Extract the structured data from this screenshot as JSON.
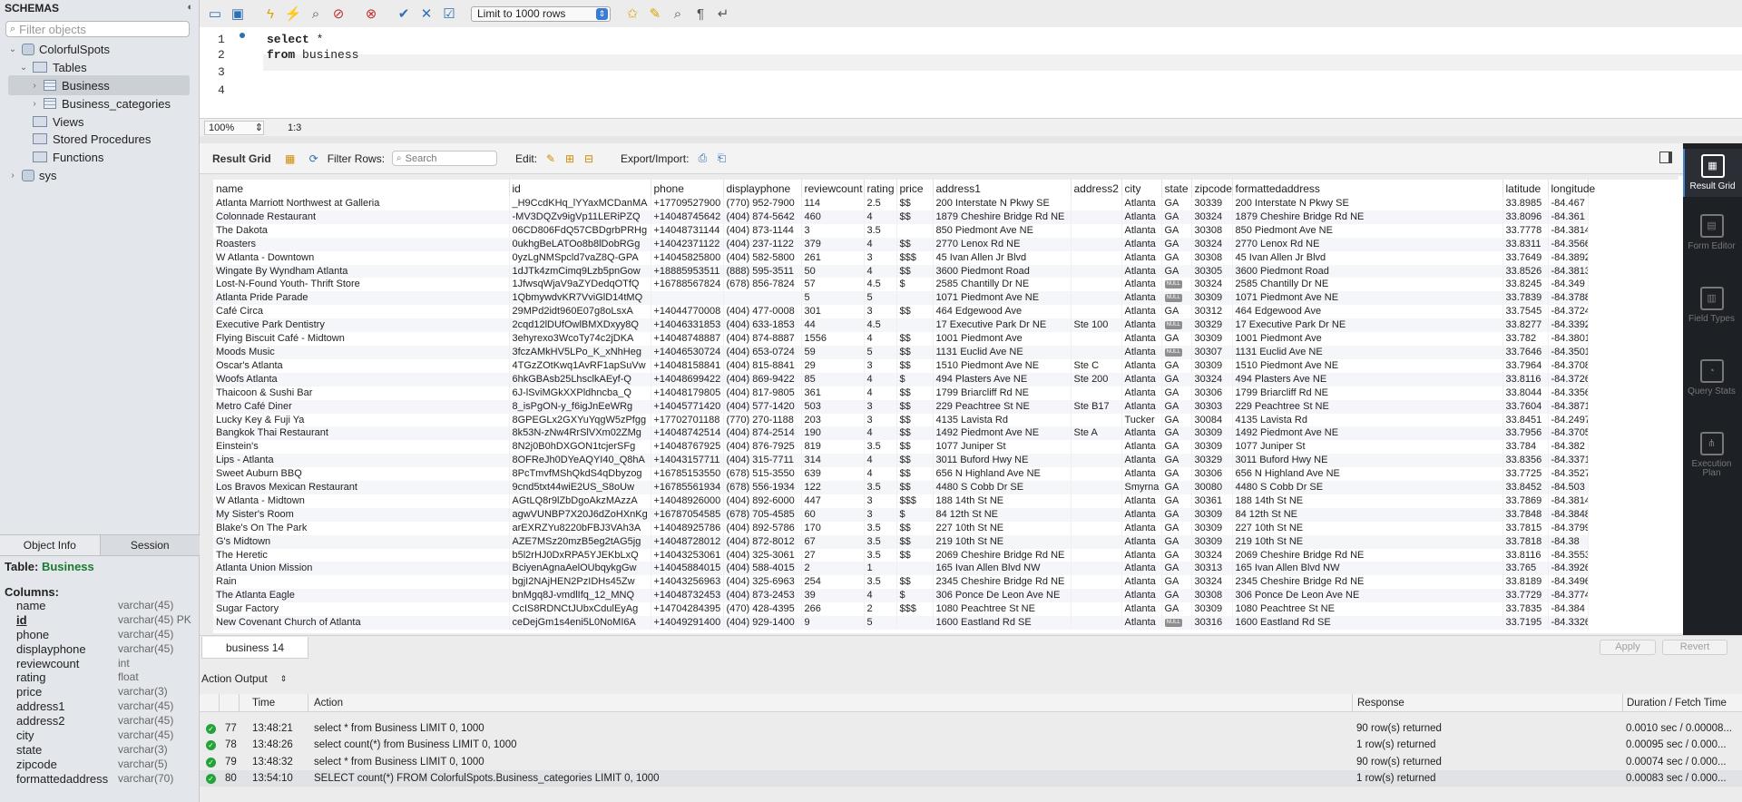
{
  "sidebar": {
    "title": "SCHEMAS",
    "filter_placeholder": "Filter objects",
    "tree": [
      {
        "label": "ColorfulSpots",
        "type": "db",
        "arrow": "⌄"
      },
      {
        "label": "Tables",
        "type": "folder",
        "arrow": "⌄"
      },
      {
        "label": "Business",
        "type": "table",
        "arrow": "›",
        "selected": true
      },
      {
        "label": "Business_categories",
        "type": "table",
        "arrow": "›"
      },
      {
        "label": "Views",
        "type": "folder",
        "arrow": ""
      },
      {
        "label": "Stored Procedures",
        "type": "folder",
        "arrow": ""
      },
      {
        "label": "Functions",
        "type": "folder",
        "arrow": ""
      },
      {
        "label": "sys",
        "type": "db",
        "arrow": "›"
      }
    ]
  },
  "object_info": {
    "tabs": [
      "Object Info",
      "Session"
    ],
    "table_prefix": "Table:",
    "table_name": "Business",
    "columns_label": "Columns:",
    "columns": [
      {
        "name": "name",
        "type": "varchar(45)"
      },
      {
        "name": "id",
        "type": "varchar(45) PK",
        "pk": true
      },
      {
        "name": "phone",
        "type": "varchar(45)"
      },
      {
        "name": "displayphone",
        "type": "varchar(45)"
      },
      {
        "name": "reviewcount",
        "type": "int"
      },
      {
        "name": "rating",
        "type": "float"
      },
      {
        "name": "price",
        "type": "varchar(3)"
      },
      {
        "name": "address1",
        "type": "varchar(45)"
      },
      {
        "name": "address2",
        "type": "varchar(45)"
      },
      {
        "name": "city",
        "type": "varchar(45)"
      },
      {
        "name": "state",
        "type": "varchar(3)"
      },
      {
        "name": "zipcode",
        "type": "varchar(5)"
      },
      {
        "name": "formattedaddress",
        "type": "varchar(70)"
      }
    ]
  },
  "toolbar": {
    "limit_label": "Limit to 1000 rows"
  },
  "editor": {
    "lines": [
      "1",
      "2",
      "3",
      "4"
    ],
    "code_line1_kw": "select",
    "code_line1_rest": " *",
    "code_line2_kw": "from",
    "code_line2_rest": " business",
    "zoom": "100%",
    "position": "1:3"
  },
  "result_toolbar": {
    "result_grid": "Result Grid",
    "filter_rows": "Filter Rows:",
    "search_placeholder": "Search",
    "edit": "Edit:",
    "export_import": "Export/Import:"
  },
  "grid": {
    "columns": [
      "name",
      "id",
      "phone",
      "displayphone",
      "reviewcount",
      "rating",
      "price",
      "address1",
      "address2",
      "city",
      "state",
      "zipcode",
      "formattedaddress",
      "latitude",
      "longitude"
    ],
    "rows": [
      [
        "Atlanta Marriott Northwest at Galleria",
        "_H9CcdKHq_lYYaxMCDanMA",
        "+17709527900",
        "(770) 952-7900",
        "114",
        "2.5",
        "$$",
        "200 Interstate N Pkwy SE",
        "",
        "Atlanta",
        "GA",
        "30339",
        "200 Interstate N Pkwy SE",
        "33.8985",
        "-84.467"
      ],
      [
        "Colonnade Restaurant",
        "-MV3DQZv9igVp11LERiPZQ",
        "+14048745642",
        "(404) 874-5642",
        "460",
        "4",
        "$$",
        "1879 Cheshire Bridge Rd NE",
        "",
        "Atlanta",
        "GA",
        "30324",
        "1879 Cheshire Bridge Rd NE",
        "33.8096",
        "-84.361"
      ],
      [
        "The Dakota",
        "06CD806FdQ57CBDgrbPRHg",
        "+14048731144",
        "(404) 873-1144",
        "3",
        "3.5",
        "",
        "850 Piedmont Ave NE",
        "",
        "Atlanta",
        "GA",
        "30308",
        "850 Piedmont Ave NE",
        "33.7778",
        "-84.3814"
      ],
      [
        "Roasters",
        "0ukhgBeLATOo8b8lDobRGg",
        "+14042371122",
        "(404) 237-1122",
        "379",
        "4",
        "$$",
        "2770 Lenox Rd NE",
        "",
        "Atlanta",
        "GA",
        "30324",
        "2770 Lenox Rd NE",
        "33.8311",
        "-84.3566"
      ],
      [
        "W Atlanta - Downtown",
        "0yzLgNMSpcld7vaZ8Q-GPA",
        "+14045825800",
        "(404) 582-5800",
        "261",
        "3",
        "$$$",
        "45 Ivan Allen Jr Blvd",
        "",
        "Atlanta",
        "GA",
        "30308",
        "45 Ivan Allen Jr Blvd",
        "33.7649",
        "-84.3892"
      ],
      [
        "Wingate By Wyndham Atlanta",
        "1dJTk4zmCimq9Lzb5pnGow",
        "+18885953511",
        "(888) 595-3511",
        "50",
        "4",
        "$$",
        "3600 Piedmont Road",
        "",
        "Atlanta",
        "GA",
        "30305",
        "3600 Piedmont Road",
        "33.8526",
        "-84.3813"
      ],
      [
        "Lost-N-Found Youth- Thrift Store",
        "1JfwsqWjaV9aZYDedqOTfQ",
        "+16788567824",
        "(678) 856-7824",
        "57",
        "4.5",
        "$",
        "2585 Chantilly Dr NE",
        "",
        "Atlanta",
        "NULL",
        "30324",
        "2585 Chantilly Dr NE",
        "33.8245",
        "-84.349"
      ],
      [
        "Atlanta Pride Parade",
        "1QbmywdvKR7VviGlD14tMQ",
        "",
        "",
        "5",
        "5",
        "",
        "1071 Piedmont Ave NE",
        "",
        "Atlanta",
        "NULL",
        "30309",
        "1071 Piedmont Ave NE",
        "33.7839",
        "-84.3788"
      ],
      [
        "Café Circa",
        "29MPd2idt960E07g8oLsxA",
        "+14044770008",
        "(404) 477-0008",
        "301",
        "3",
        "$$",
        "464 Edgewood Ave",
        "",
        "Atlanta",
        "GA",
        "30312",
        "464 Edgewood Ave",
        "33.7545",
        "-84.3724"
      ],
      [
        "Executive Park Dentistry",
        "2cqd12lDUfOwlBMXDxyy8Q",
        "+14046331853",
        "(404) 633-1853",
        "44",
        "4.5",
        "",
        "17 Executive Park Dr NE",
        "Ste 100",
        "Atlanta",
        "NULL",
        "30329",
        "17 Executive Park Dr NE",
        "33.8277",
        "-84.3392"
      ],
      [
        "Flying Biscuit Café - Midtown",
        "3ehyrexo3WcoTy74c2jDKA",
        "+14048748887",
        "(404) 874-8887",
        "1556",
        "4",
        "$$",
        "1001 Piedmont Ave",
        "",
        "Atlanta",
        "GA",
        "30309",
        "1001 Piedmont Ave",
        "33.782",
        "-84.3801"
      ],
      [
        "Moods Music",
        "3fczAMkHV5LPo_K_xNhHeg",
        "+14046530724",
        "(404) 653-0724",
        "59",
        "5",
        "$$",
        "1131 Euclid Ave NE",
        "",
        "Atlanta",
        "NULL",
        "30307",
        "1131 Euclid Ave NE",
        "33.7646",
        "-84.3501"
      ],
      [
        "Oscar's Atlanta",
        "4TGzZOtKwq1AvRF1apSuVw",
        "+14048158841",
        "(404) 815-8841",
        "29",
        "3",
        "$$",
        "1510 Piedmont Ave NE",
        "Ste C",
        "Atlanta",
        "GA",
        "30309",
        "1510 Piedmont Ave NE",
        "33.7964",
        "-84.3708"
      ],
      [
        "Woofs Atlanta",
        "6hkGBAsb25LhsclkAEyf-Q",
        "+14048699422",
        "(404) 869-9422",
        "85",
        "4",
        "$",
        "494 Plasters Ave NE",
        "Ste 200",
        "Atlanta",
        "GA",
        "30324",
        "494 Plasters Ave NE",
        "33.8116",
        "-84.3726"
      ],
      [
        "Thaicoon & Sushi Bar",
        "6J-lSviMGkXXPldhncba_Q",
        "+14048179805",
        "(404) 817-9805",
        "361",
        "4",
        "$$",
        "1799 Briarcliff Rd NE",
        "",
        "Atlanta",
        "GA",
        "30306",
        "1799 Briarcliff Rd NE",
        "33.8044",
        "-84.3356"
      ],
      [
        "Metro Café Diner",
        "8_isPgON-y_f6igJnEeWRg",
        "+14045771420",
        "(404) 577-1420",
        "503",
        "3",
        "$$",
        "229 Peachtree St NE",
        "Ste B17",
        "Atlanta",
        "GA",
        "30303",
        "229 Peachtree St NE",
        "33.7604",
        "-84.3871"
      ],
      [
        "Lucky Key & Fuji Ya",
        "8GPEGLx2GXYuYqgW5zPfgg",
        "+17702701188",
        "(770) 270-1188",
        "203",
        "3",
        "$$",
        "4135 Lavista Rd",
        "",
        "Tucker",
        "GA",
        "30084",
        "4135 Lavista Rd",
        "33.8451",
        "-84.2497"
      ],
      [
        "Bangkok Thai Restaurant",
        "8k53N-zNw4RrSlVXm02ZMg",
        "+14048742514",
        "(404) 874-2514",
        "190",
        "4",
        "$$",
        "1492 Piedmont Ave NE",
        "Ste A",
        "Atlanta",
        "GA",
        "30309",
        "1492 Piedmont Ave NE",
        "33.7956",
        "-84.3705"
      ],
      [
        "Einstein's",
        "8N2j0B0hDXGON1tcjerSFg",
        "+14048767925",
        "(404) 876-7925",
        "819",
        "3.5",
        "$$",
        "1077 Juniper St",
        "",
        "Atlanta",
        "GA",
        "30309",
        "1077 Juniper St",
        "33.784",
        "-84.382"
      ],
      [
        "Lips - Atlanta",
        "8OFReJh0DYeAQYI40_Q8hA",
        "+14043157711",
        "(404) 315-7711",
        "314",
        "4",
        "$$",
        "3011 Buford Hwy NE",
        "",
        "Atlanta",
        "GA",
        "30329",
        "3011 Buford Hwy NE",
        "33.8356",
        "-84.3371"
      ],
      [
        "Sweet Auburn BBQ",
        "8PcTmvfMShQkdS4qDbyzog",
        "+16785153550",
        "(678) 515-3550",
        "639",
        "4",
        "$$",
        "656 N Highland Ave NE",
        "",
        "Atlanta",
        "GA",
        "30306",
        "656 N Highland Ave NE",
        "33.7725",
        "-84.3527"
      ],
      [
        "Los Bravos Mexican Restaurant",
        "9cnd5txt44wiE2US_S8oUw",
        "+16785561934",
        "(678) 556-1934",
        "122",
        "3.5",
        "$$",
        "4480 S Cobb Dr SE",
        "",
        "Smyrna",
        "GA",
        "30080",
        "4480 S Cobb Dr SE",
        "33.8452",
        "-84.503"
      ],
      [
        "W Atlanta - Midtown",
        "AGtLQ8r9lZbDgoAkzMAzzA",
        "+14048926000",
        "(404) 892-6000",
        "447",
        "3",
        "$$$",
        "188 14th St NE",
        "",
        "Atlanta",
        "GA",
        "30361",
        "188 14th St NE",
        "33.7869",
        "-84.3814"
      ],
      [
        "My Sister's Room",
        "agwVUNBP7X20J6dZoHXnKg",
        "+16787054585",
        "(678) 705-4585",
        "60",
        "3",
        "$",
        "84 12th St NE",
        "",
        "Atlanta",
        "GA",
        "30309",
        "84 12th St NE",
        "33.7848",
        "-84.3848"
      ],
      [
        "Blake's On The Park",
        "arEXRZYu8220bFBJ3VAh3A",
        "+14048925786",
        "(404) 892-5786",
        "170",
        "3.5",
        "$$",
        "227 10th St NE",
        "",
        "Atlanta",
        "GA",
        "30309",
        "227 10th St NE",
        "33.7815",
        "-84.3799"
      ],
      [
        "G's Midtown",
        "AZE7MSz20mzB5eg2tAG5jg",
        "+14048728012",
        "(404) 872-8012",
        "67",
        "3.5",
        "$$",
        "219 10th St NE",
        "",
        "Atlanta",
        "GA",
        "30309",
        "219 10th St NE",
        "33.7818",
        "-84.38"
      ],
      [
        "The Heretic",
        "b5l2rHJ0DxRPA5YJEKbLxQ",
        "+14043253061",
        "(404) 325-3061",
        "27",
        "3.5",
        "$$",
        "2069 Cheshire Bridge Rd NE",
        "",
        "Atlanta",
        "GA",
        "30324",
        "2069 Cheshire Bridge Rd NE",
        "33.8116",
        "-84.3553"
      ],
      [
        "Atlanta Union Mission",
        "BciyenAgnaAelOUbqykgGw",
        "+14045884015",
        "(404) 588-4015",
        "2",
        "1",
        "",
        "165 Ivan Allen Blvd NW",
        "",
        "Atlanta",
        "GA",
        "30313",
        "165 Ivan Allen Blvd NW",
        "33.765",
        "-84.3926"
      ],
      [
        "Rain",
        "bgjI2NAjHEN2PzIDHs45Zw",
        "+14043256963",
        "(404) 325-6963",
        "254",
        "3.5",
        "$$",
        "2345 Cheshire Bridge Rd NE",
        "",
        "Atlanta",
        "GA",
        "30324",
        "2345 Cheshire Bridge Rd NE",
        "33.8189",
        "-84.3496"
      ],
      [
        "The Atlanta Eagle",
        "bnMgq8J-vmdlIfq_12_MNQ",
        "+14048732453",
        "(404) 873-2453",
        "39",
        "4",
        "$",
        "306 Ponce De Leon Ave NE",
        "",
        "Atlanta",
        "GA",
        "30308",
        "306 Ponce De Leon Ave NE",
        "33.7729",
        "-84.3774"
      ],
      [
        "Sugar Factory",
        "CcIS8RDNCtJUbxCdulEyAg",
        "+14704284395",
        "(470) 428-4395",
        "266",
        "2",
        "$$$",
        "1080 Peachtree St NE",
        "",
        "Atlanta",
        "GA",
        "30309",
        "1080 Peachtree St NE",
        "33.7835",
        "-84.384"
      ],
      [
        "New Covenant Church of Atlanta",
        "ceDejGm1s4eni5L0NoMI6A",
        "+14049291400",
        "(404) 929-1400",
        "9",
        "5",
        "",
        "1600 Eastland Rd SE",
        "",
        "Atlanta",
        "NULL",
        "30316",
        "1600 Eastland Rd SE",
        "33.7195",
        "-84.3326"
      ]
    ]
  },
  "right_panel": [
    {
      "label": "Result Grid",
      "icon": "result-grid-icon",
      "active": true
    },
    {
      "label": "Form Editor",
      "icon": "form-editor-icon"
    },
    {
      "label": "Field Types",
      "icon": "field-types-icon"
    },
    {
      "label": "Query Stats",
      "icon": "query-stats-icon"
    },
    {
      "label": "Execution Plan",
      "icon": "execution-plan-icon"
    }
  ],
  "footer": {
    "tab": "business 14",
    "apply": "Apply",
    "revert": "Revert"
  },
  "action_output": {
    "label": "Action Output",
    "headers": {
      "time": "Time",
      "action": "Action",
      "response": "Response",
      "duration": "Duration / Fetch Time"
    },
    "rows": [
      {
        "n": "77",
        "time": "13:48:21",
        "action": "select * from Business LIMIT 0, 1000",
        "response": "90 row(s) returned",
        "duration": "0.0010 sec / 0.00008..."
      },
      {
        "n": "78",
        "time": "13:48:26",
        "action": "select count(*) from Business LIMIT 0, 1000",
        "response": "1 row(s) returned",
        "duration": "0.00095 sec / 0.000..."
      },
      {
        "n": "79",
        "time": "13:48:32",
        "action": "select * from Business LIMIT 0, 1000",
        "response": "90 row(s) returned",
        "duration": "0.00074 sec / 0.000..."
      },
      {
        "n": "80",
        "time": "13:54:10",
        "action": "SELECT count(*) FROM ColorfulSpots.Business_categories LIMIT 0, 1000",
        "response": "1 row(s) returned",
        "duration": "0.00083 sec / 0.000..."
      }
    ]
  }
}
